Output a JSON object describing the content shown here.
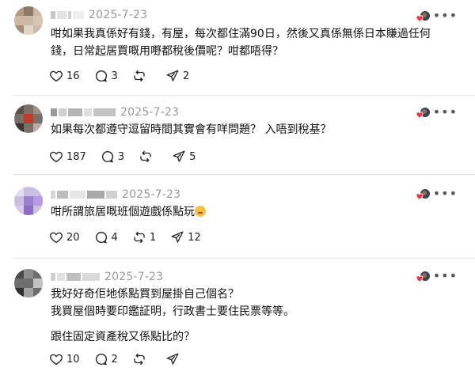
{
  "posts": [
    {
      "date": "2025-7-23",
      "lines": [
        "咁如果我真係好有錢，有屋，每次都住滿90日，然後又真係無係日本賺過任何",
        "錢，日常起居買嘅用嘢都稅後價呢？咁都唔得？"
      ],
      "likes": "16",
      "replies": "3",
      "reposts": "",
      "shares": "2"
    },
    {
      "date": "2025-7-23",
      "lines": [
        "如果每次都遵守逗留時間其實會有咩問題？ 入唔到稅基？"
      ],
      "likes": "187",
      "replies": "3",
      "reposts": "",
      "shares": "5"
    },
    {
      "date": "2025-7-23",
      "lines": [
        "咁所謂旅居嘅班個遊戲係點玩"
      ],
      "likes": "20",
      "replies": "4",
      "reposts": "1",
      "shares": "12"
    },
    {
      "date": "2025-7-23",
      "lines": [
        "我好好奇佢地係點買到屋掛自己個名？",
        "我買屋個時要印鑑証明，行政書士要住民票等等。"
      ],
      "lines2": [
        "跟住固定資產稅又係點比的？"
      ],
      "likes": "10",
      "replies": "2",
      "reposts": "",
      "shares": ""
    }
  ],
  "icons": {
    "like": "heart-icon",
    "reply": "comment-icon",
    "repost": "repost-icon",
    "share": "send-icon",
    "more": "more-icon",
    "author_liked": "author-liked-icon"
  },
  "colors": {
    "author_heart": "#ff3040",
    "date": "#999999",
    "divider": "#e5e5e5"
  }
}
